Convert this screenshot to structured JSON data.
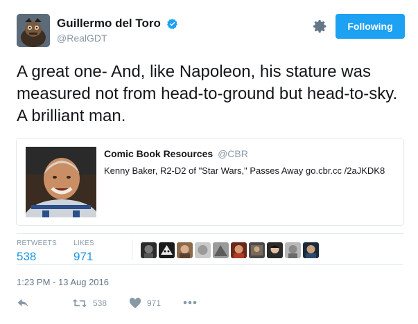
{
  "author": {
    "display_name": "Guillermo del Toro",
    "handle": "@RealGDT",
    "verified_icon": "verified-badge-icon"
  },
  "header": {
    "follow_button_label": "Following",
    "settings_icon": "gear-icon"
  },
  "tweet": {
    "text": "A great one- And, like Napoleon, his stature was measured not from head-to-ground but head-to-sky.  A brilliant man."
  },
  "card": {
    "source_name": "Comic Book Resources",
    "source_handle": "@CBR",
    "body": "Kenny Baker, R2-D2 of \"Star Wars,\" Passes Away go.cbr.cc /2aJKDK8"
  },
  "stats": {
    "retweets_label": "RETWEETS",
    "retweets_value": "538",
    "likes_label": "LIKES",
    "likes_value": "971"
  },
  "timestamp": "1:23 PM - 13 Aug 2016",
  "actions": {
    "retweet_count": "538",
    "like_count": "971"
  },
  "colors": {
    "accent": "#1da1f2",
    "link_blue": "#1b95e0",
    "muted": "#8899a6"
  }
}
